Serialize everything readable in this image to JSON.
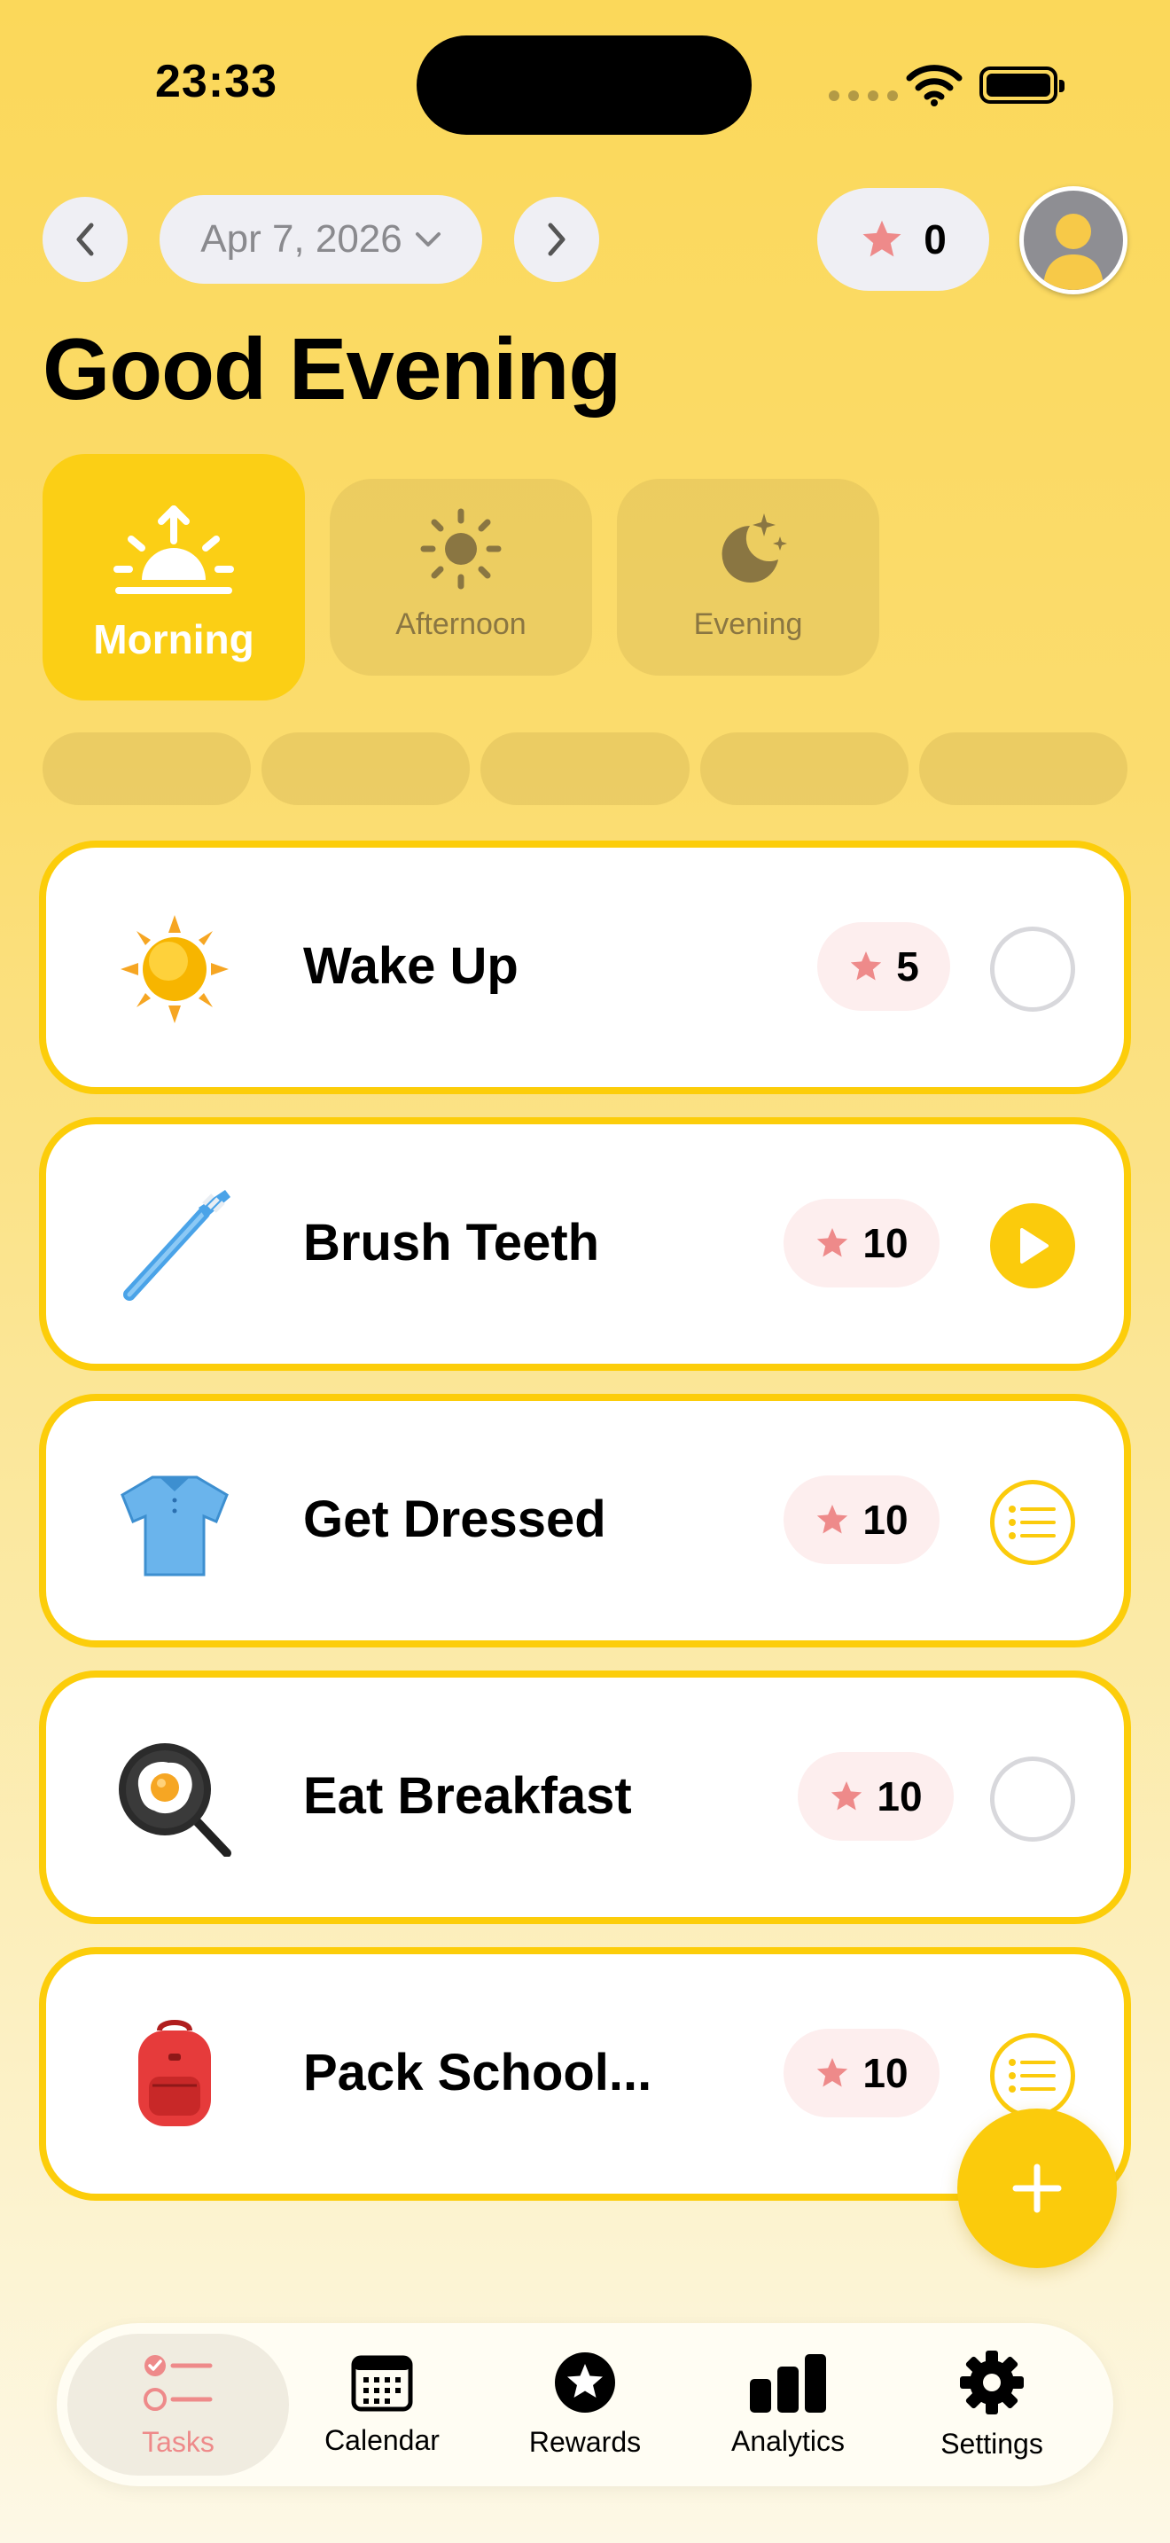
{
  "status_bar": {
    "time": "23:33"
  },
  "header": {
    "date": "Apr 7, 2026",
    "points": "0",
    "greeting": "Good Evening"
  },
  "time_of_day": [
    {
      "label": "Morning",
      "active": true
    },
    {
      "label": "Afternoon",
      "active": false
    },
    {
      "label": "Evening",
      "active": false
    }
  ],
  "tasks": [
    {
      "title": "Wake Up",
      "points": "5",
      "icon": "sun-icon",
      "status": "empty-circle"
    },
    {
      "title": "Brush Teeth",
      "points": "10",
      "icon": "toothbrush-icon",
      "status": "play"
    },
    {
      "title": "Get Dressed",
      "points": "10",
      "icon": "tshirt-icon",
      "status": "checklist"
    },
    {
      "title": "Eat Breakfast",
      "points": "10",
      "icon": "frying-pan-egg-icon",
      "status": "empty-circle"
    },
    {
      "title": "Pack School...",
      "points": "10",
      "icon": "backpack-icon",
      "status": "checklist"
    }
  ],
  "tab_bar": {
    "items": [
      {
        "label": "Tasks",
        "icon": "checklist-icon",
        "active": true
      },
      {
        "label": "Calendar",
        "icon": "calendar-icon",
        "active": false
      },
      {
        "label": "Rewards",
        "icon": "star-badge-icon",
        "active": false
      },
      {
        "label": "Analytics",
        "icon": "bar-chart-icon",
        "active": false
      },
      {
        "label": "Settings",
        "icon": "gear-icon",
        "active": false
      }
    ]
  },
  "colors": {
    "accent": "#fbcb0c",
    "star": "#ee8a8a",
    "badge_bg": "#fdeeee",
    "card_border": "#fccd0a"
  }
}
